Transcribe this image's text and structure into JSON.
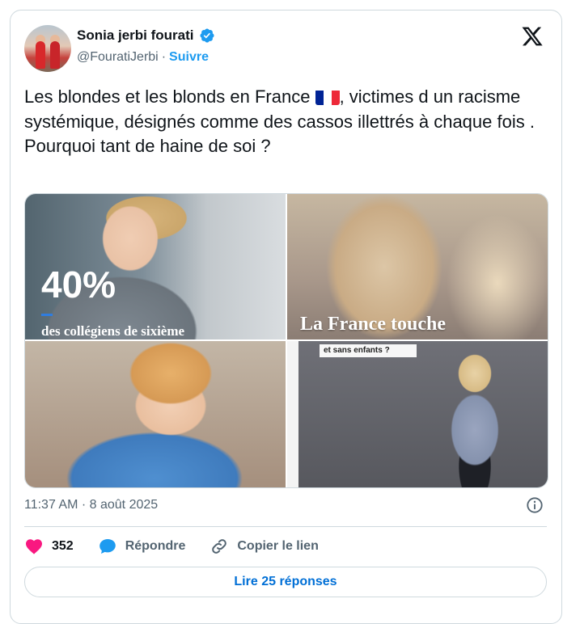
{
  "author": {
    "name": "Sonia jerbi fourati",
    "handle": "@FouratiJerbi",
    "separator": "·",
    "follow_label": "Suivre",
    "verified": true
  },
  "tweet": {
    "text_part1": "Les blondes et les blonds en France ",
    "flag_icon": "french-flag",
    "text_part2": ", victimes d un racisme systémique, désignés comme des cassos illettrés à chaque fois .\nPourquoi tant de haine de soi ?"
  },
  "media": [
    {
      "overlay_big": "40%",
      "overlay_caption": "des collégiens de sixième"
    },
    {
      "overlay_caption": "La France touche"
    },
    {},
    {
      "overlay_caption": "et sans enfants ?"
    }
  ],
  "meta": {
    "timestamp": "11:37 AM · 8 août 2025"
  },
  "actions": {
    "likes_count": "352",
    "reply_label": "Répondre",
    "copy_link_label": "Copier le lien"
  },
  "replies_button": "Lire 25 réponses",
  "colors": {
    "accent": "#1d9bf0",
    "like": "#f91880",
    "text_secondary": "#536471",
    "border": "#cfd9de"
  }
}
